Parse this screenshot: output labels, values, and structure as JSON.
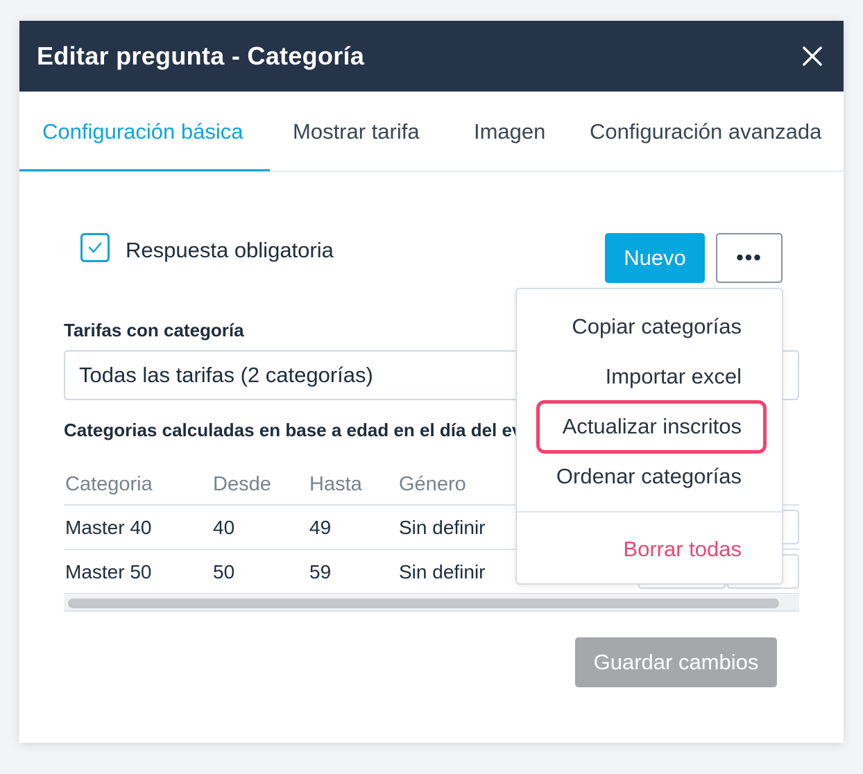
{
  "modal": {
    "title": "Editar pregunta - Categoría",
    "close_icon": "close-icon"
  },
  "tabs": [
    {
      "label": "Configuración básica",
      "active": true
    },
    {
      "label": "Mostrar tarifa",
      "active": false
    },
    {
      "label": "Imagen",
      "active": false
    },
    {
      "label": "Configuración avanzada",
      "active": false
    }
  ],
  "required": {
    "label": "Respuesta obligatoria",
    "checked": true
  },
  "actions": {
    "new_label": "Nuevo",
    "more_label": "•••"
  },
  "rates": {
    "label": "Tarifas con categoría",
    "selected": "Todas las tarifas (2 categorías)"
  },
  "note": "Categorias calculadas en base a edad en el día del eve",
  "table": {
    "headers": [
      "Categoria",
      "Desde",
      "Hasta",
      "Género"
    ],
    "rows": [
      [
        "Master 40",
        "40",
        "49",
        "Sin definir"
      ],
      [
        "Master 50",
        "50",
        "59",
        "Sin definir"
      ]
    ]
  },
  "menu": {
    "items": [
      "Copiar categorías",
      "Importar excel",
      "Actualizar inscritos",
      "Ordenar categorías"
    ],
    "danger_item": "Borrar todas"
  },
  "save_label": "Guardar cambios",
  "colors": {
    "header_bg": "#263449",
    "accent": "#0ea4dd",
    "danger": "#f0476f",
    "highlight": "#f4416c",
    "disabled": "#a5a7aa"
  }
}
